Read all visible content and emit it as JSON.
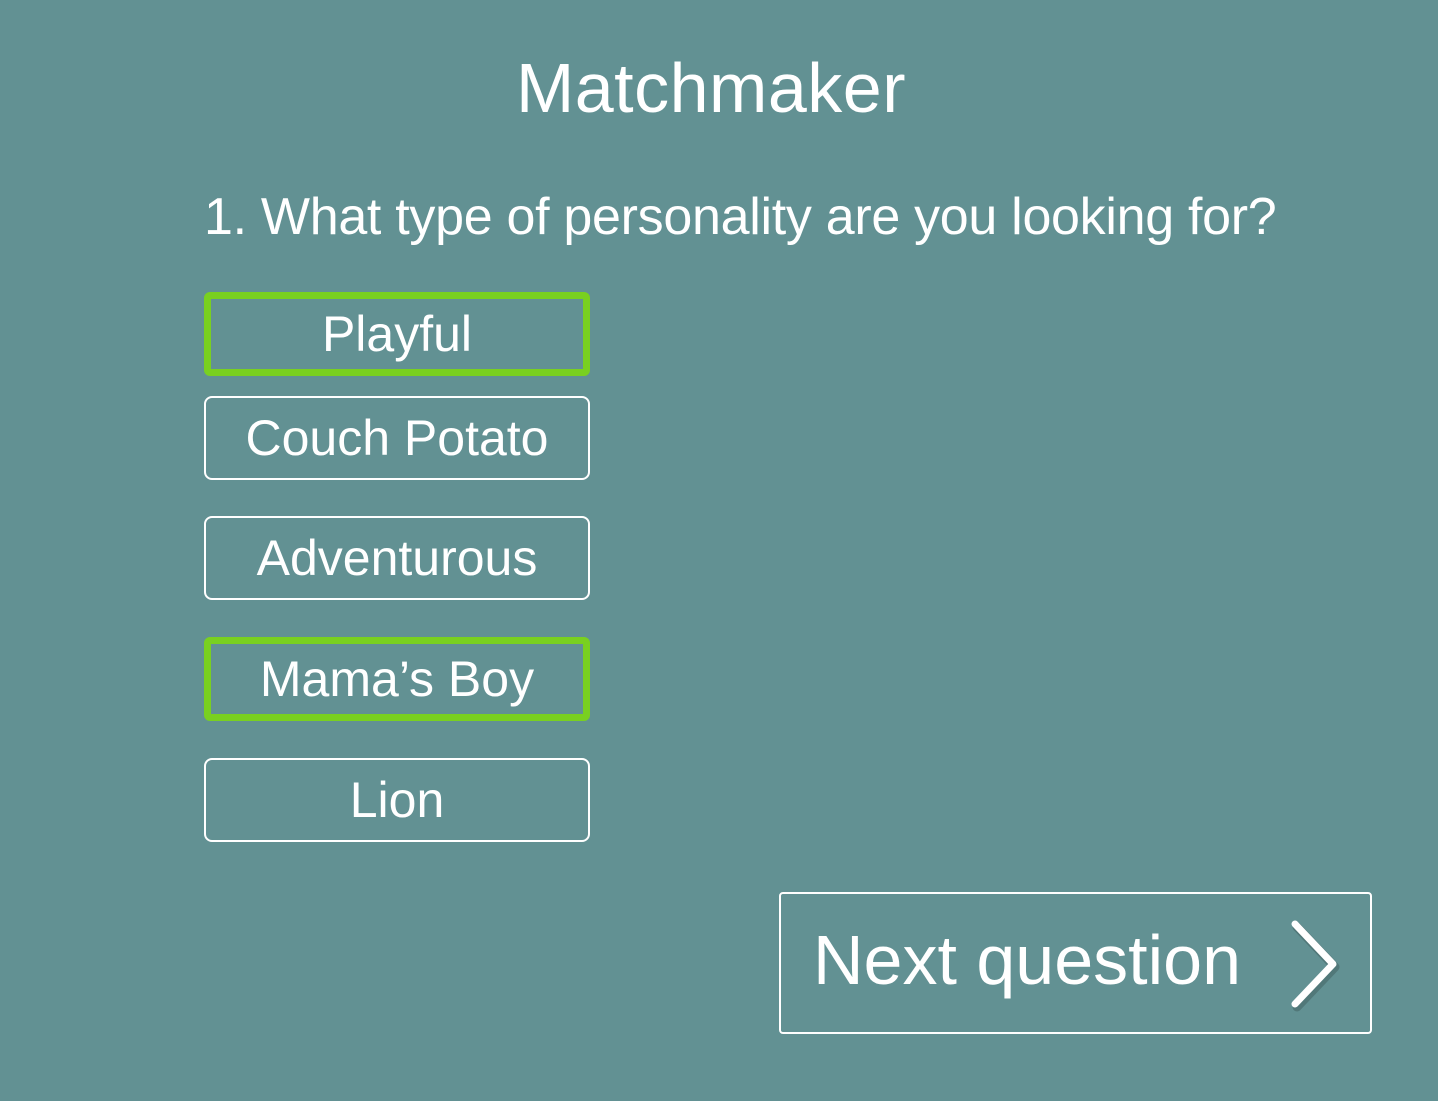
{
  "app": {
    "title": "Matchmaker"
  },
  "question": {
    "text": "1. What type of personality are you looking for?"
  },
  "options": [
    {
      "label": "Playful",
      "selected": true
    },
    {
      "label": "Couch Potato",
      "selected": false
    },
    {
      "label": "Adventurous",
      "selected": false
    },
    {
      "label": "Mama’s Boy",
      "selected": true
    },
    {
      "label": "Lion",
      "selected": false
    }
  ],
  "next": {
    "label": "Next question",
    "icon": "chevron-right-icon"
  },
  "colors": {
    "background": "#629193",
    "selected_border": "#79d020",
    "text": "#ffffff"
  }
}
